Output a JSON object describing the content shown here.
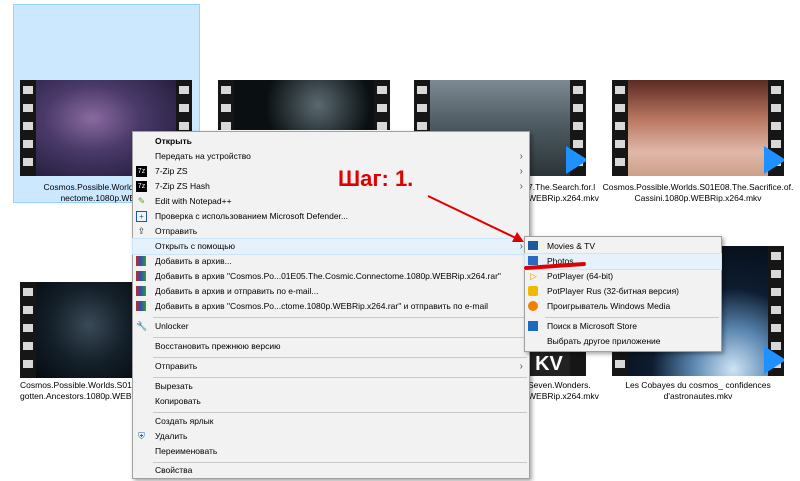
{
  "files": [
    {
      "caption1": "Cosmos.Possible.Worlds.S01E05",
      "caption2": "nectome.1080p.WEBRip"
    },
    {
      "caption1": "",
      "caption2": ""
    },
    {
      "caption1": "7.The.Search.for.l",
      "caption2": "WEBRip.x264.mkv"
    },
    {
      "caption1": "Cosmos.Possible.Worlds.S01E08.The.Sacrifice.of.",
      "caption2": "Cassini.1080p.WEBRip.x264.mkv"
    },
    {
      "caption1": "Cosmos.Possible.Worlds.S01E0",
      "caption2": "gotten.Ancestors.1080p.WEBRi"
    },
    {
      "caption1": "Seven.Wonders.",
      "caption2": "WEBRip.x264.mkv"
    },
    {
      "caption1": "Les Cobayes du cosmos_ confidences",
      "caption2": "d'astronautes.mkv"
    }
  ],
  "context_menu": {
    "open": "Открыть",
    "send_to_device": "Передать на устройство",
    "zip_zs": "7-Zip ZS",
    "zip_hash": "7-Zip ZS Hash",
    "notepad": "Edit with Notepad++",
    "defender": "Проверка с использованием Microsoft Defender...",
    "share": "Отправить",
    "open_with": "Открыть с помощью",
    "add_archive": "Добавить в архив...",
    "add_archive_rar": "Добавить в архив \"Cosmos.Po...01E05.The.Cosmic.Connectome.1080p.WEBRip.x264.rar\"",
    "add_archive_email": "Добавить в архив и отправить по e-mail...",
    "add_archive_rar_email": "Добавить в архив \"Cosmos.Po...ctome.1080p.WEBRip.x264.rar\" и отправить по e-mail",
    "unlocker": "Unlocker",
    "restore": "Восстановить прежнюю версию",
    "send_to": "Отправить",
    "cut": "Вырезать",
    "copy": "Копировать",
    "create_shortcut": "Создать ярлык",
    "delete": "Удалить",
    "rename": "Переименовать",
    "properties": "Свойства"
  },
  "submenu": {
    "movies_tv": "Movies & TV",
    "photos": "Photos",
    "potplayer": "PotPlayer (64-bit)",
    "potplayer_rus": "PotPlayer Rus (32-битная версия)",
    "wmp": "Проигрыватель Windows Media",
    "store": "Поиск в Microsoft Store",
    "choose_other": "Выбрать другое приложение"
  },
  "annotation": {
    "step": "Шаг: 1."
  },
  "colors": {
    "accent": "#1e90ff",
    "annotation": "#e00000",
    "selection": "#cce8ff"
  }
}
